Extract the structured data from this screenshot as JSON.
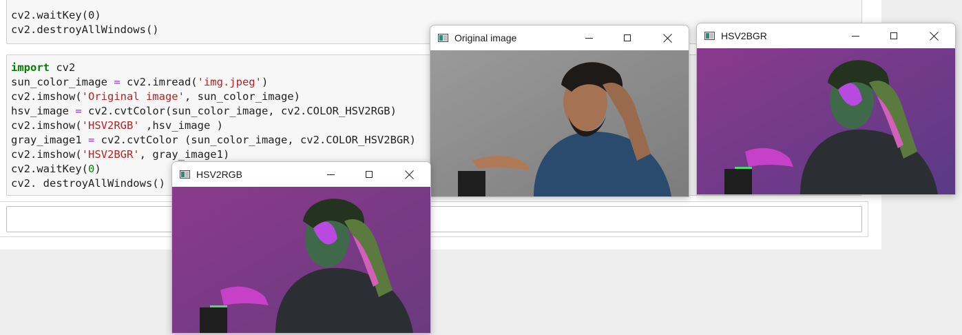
{
  "notebook": {
    "cell_prev": {
      "lines": [
        "cv2.waitKey(0)",
        "cv2.destroyAllWindows()"
      ]
    },
    "cell_code": {
      "l1_kw": "import",
      "l1_rest": " cv2",
      "l2_a": "sun_color_image ",
      "l2_eq": "=",
      "l2_b": " cv2.imread(",
      "l2_str": "'img.jpeg'",
      "l2_c": ")",
      "l3_a": "cv2.imshow(",
      "l3_str": "'Original image'",
      "l3_b": ", sun_color_image)",
      "l4_a": "hsv_image ",
      "l4_eq": "=",
      "l4_b": " cv2.cvtColor(sun_color_image, cv2.COLOR_HSV2RGB)",
      "l5_a": "cv2.imshow(",
      "l5_str": "'HSV2RGB'",
      "l5_b": " ,hsv_image )",
      "l6_a": "gray_image1 ",
      "l6_eq": "=",
      "l6_b": " cv2.cvtColor (sun_color_image, cv2.COLOR_HSV2BGR)",
      "l7_a": "cv2.imshow(",
      "l7_str": "'HSV2BGR'",
      "l7_b": ", gray_image1)",
      "l8_a": "cv2.waitKey(",
      "l8_num": "0",
      "l8_b": ")",
      "l9": "cv2. destroyAllWindows()"
    }
  },
  "windows": {
    "original": {
      "title": "Original image",
      "icon": "opencv-window-icon"
    },
    "hsv2bgr": {
      "title": "HSV2BGR",
      "icon": "opencv-window-icon"
    },
    "hsv2rgb": {
      "title": "HSV2RGB",
      "icon": "opencv-window-icon"
    }
  },
  "colors": {
    "keyword": "#008000",
    "string": "#ba2121",
    "operator": "#aa22ff",
    "cell_bg": "#f7f7f7"
  }
}
